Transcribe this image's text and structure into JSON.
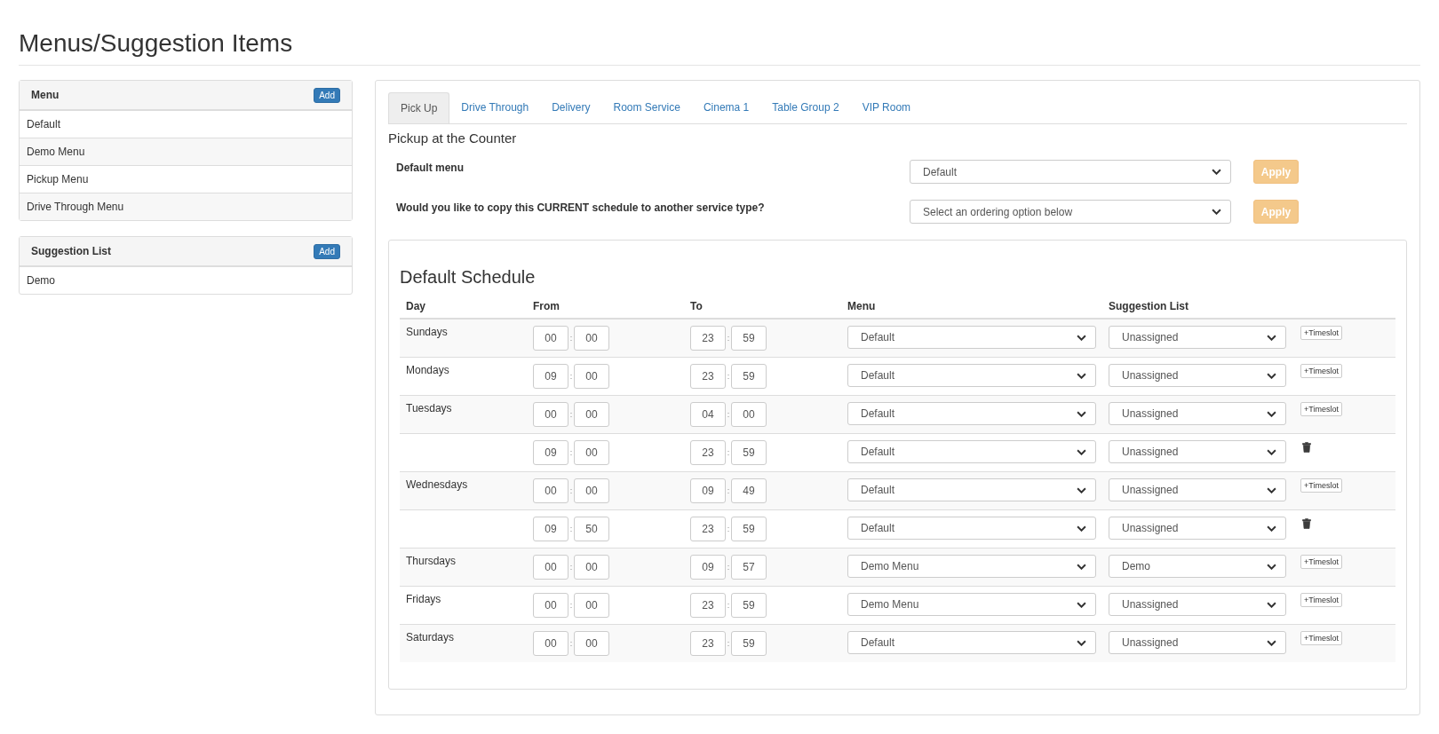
{
  "page_title": "Menus/Suggestion Items",
  "sidebar": [
    {
      "title": "Menu",
      "add_label": "Add",
      "items": [
        "Default",
        "Demo Menu",
        "Pickup Menu",
        "Drive Through Menu"
      ]
    },
    {
      "title": "Suggestion List",
      "add_label": "Add",
      "items": [
        "Demo"
      ]
    }
  ],
  "tabs": [
    {
      "label": "Pick Up",
      "selected": true
    },
    {
      "label": "Drive Through",
      "selected": false
    },
    {
      "label": "Delivery",
      "selected": false
    },
    {
      "label": "Room Service",
      "selected": false
    },
    {
      "label": "Cinema 1",
      "selected": false
    },
    {
      "label": "Table Group 2",
      "selected": false
    },
    {
      "label": "VIP Room",
      "selected": false
    }
  ],
  "service_heading": "Pickup at the Counter",
  "settings": [
    {
      "label": "Default menu",
      "value": "Default",
      "button": "Apply"
    },
    {
      "label": "Would you like to copy this CURRENT schedule to another service type?",
      "value": "Select an ordering option below",
      "button": "Apply"
    }
  ],
  "schedule": {
    "title": "Default Schedule",
    "columns": [
      "Day",
      "From",
      "To",
      "Menu",
      "Suggestion List"
    ],
    "rows": [
      {
        "day": "Sundays",
        "from": {
          "hour": "00",
          "sep": ":",
          "minute": "00"
        },
        "to": {
          "hour": "23",
          "sep": ":",
          "minute": "59"
        },
        "menu": "Default",
        "suggestion": "Unassigned",
        "action": {
          "kind": "add",
          "label": "+Timeslot"
        }
      },
      {
        "day": "Mondays",
        "from": {
          "hour": "09",
          "sep": ":",
          "minute": "00"
        },
        "to": {
          "hour": "23",
          "sep": ":",
          "minute": "59"
        },
        "menu": "Default",
        "suggestion": "Unassigned",
        "action": {
          "kind": "add",
          "label": "+Timeslot"
        }
      },
      {
        "day": "Tuesdays",
        "from": {
          "hour": "00",
          "sep": ":",
          "minute": "00"
        },
        "to": {
          "hour": "04",
          "sep": ":",
          "minute": "00"
        },
        "menu": "Default",
        "suggestion": "Unassigned",
        "action": {
          "kind": "add",
          "label": "+Timeslot"
        }
      },
      {
        "from": {
          "hour": "09",
          "sep": ":",
          "minute": "00"
        },
        "to": {
          "hour": "23",
          "sep": ":",
          "minute": "59"
        },
        "menu": "Default",
        "suggestion": "Unassigned",
        "action": {
          "kind": "delete"
        }
      },
      {
        "day": "Wednesdays",
        "from": {
          "hour": "00",
          "sep": ":",
          "minute": "00"
        },
        "to": {
          "hour": "09",
          "sep": ":",
          "minute": "49"
        },
        "menu": "Default",
        "suggestion": "Unassigned",
        "action": {
          "kind": "add",
          "label": "+Timeslot"
        }
      },
      {
        "from": {
          "hour": "09",
          "sep": ":",
          "minute": "50"
        },
        "to": {
          "hour": "23",
          "sep": ":",
          "minute": "59"
        },
        "menu": "Default",
        "suggestion": "Unassigned",
        "action": {
          "kind": "delete"
        }
      },
      {
        "day": "Thursdays",
        "from": {
          "hour": "00",
          "sep": ":",
          "minute": "00"
        },
        "to": {
          "hour": "09",
          "sep": ":",
          "minute": "57"
        },
        "menu": "Demo Menu",
        "suggestion": "Demo",
        "action": {
          "kind": "add",
          "label": "+Timeslot"
        }
      },
      {
        "day": "Fridays",
        "from": {
          "hour": "00",
          "sep": ":",
          "minute": "00"
        },
        "to": {
          "hour": "23",
          "sep": ":",
          "minute": "59"
        },
        "menu": "Demo Menu",
        "suggestion": "Unassigned",
        "action": {
          "kind": "add",
          "label": "+Timeslot"
        }
      },
      {
        "day": "Saturdays",
        "from": {
          "hour": "00",
          "sep": ":",
          "minute": "00"
        },
        "to": {
          "hour": "23",
          "sep": ":",
          "minute": "59"
        },
        "menu": "Default",
        "suggestion": "Unassigned",
        "action": {
          "kind": "add",
          "label": "+Timeslot"
        }
      }
    ]
  }
}
